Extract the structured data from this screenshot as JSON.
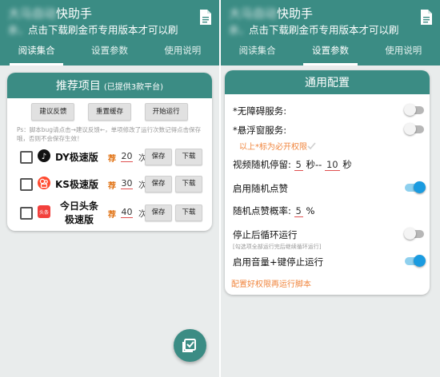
{
  "app": {
    "title_blurred": "大马自动",
    "title_visible": "快助手",
    "subtitle_blurred": "亲，",
    "subtitle_visible": "点击下载刷金币专用版本才可以刷"
  },
  "tabs": [
    {
      "label": "阅读集合"
    },
    {
      "label": "设置参数"
    },
    {
      "label": "使用说明"
    }
  ],
  "left_card": {
    "title": "推荐项目",
    "title_sub": "(已提供3款平台)",
    "buttons": {
      "feedback": "建议反馈",
      "reset": "重置缓存",
      "start": "开始运行"
    },
    "ps_note": "Ps：脚本bug请点击→建议反馈←，单项修改了运行次数记得点击保存哦，否则不会保存生效！",
    "jian": "荐",
    "unit": "次",
    "save": "保存",
    "download": "下载",
    "apps": [
      {
        "name": "DY极速版",
        "count": "20"
      },
      {
        "name": "KS极速版",
        "count": "30"
      },
      {
        "name": "今日头条",
        "name2": "极速版",
        "count": "40",
        "icon_text": "头条"
      }
    ]
  },
  "right_card": {
    "title": "通用配置",
    "accessibility": "*无障碍服务:",
    "floating": "*悬浮窗服务:",
    "required_note": "以上*标为必开权限",
    "video_stay_label": "视频随机停留:",
    "video_min": "5",
    "video_sep": "秒--",
    "video_max": "10",
    "video_unit": "秒",
    "random_like": "启用随机点赞",
    "like_prob_label": "随机点赞概率:",
    "like_prob": "5",
    "like_prob_unit": "%",
    "loop_after_stop": "停止后循环运行",
    "loop_hint": "[勾选项全部运行完后继续循环运行]",
    "volume_stop": "启用音量+键停止运行",
    "config_note": "配置好权限再运行脚本"
  },
  "toggles": {
    "accessibility": false,
    "floating": false,
    "random_like": true,
    "loop": false,
    "volume": true
  },
  "colors": {
    "primary": "#3b8c84",
    "accent_orange": "#f0853d",
    "toggle_on": "#1a9be0"
  },
  "icons": {
    "header": "document-icon",
    "fab": "checklist-icon"
  }
}
